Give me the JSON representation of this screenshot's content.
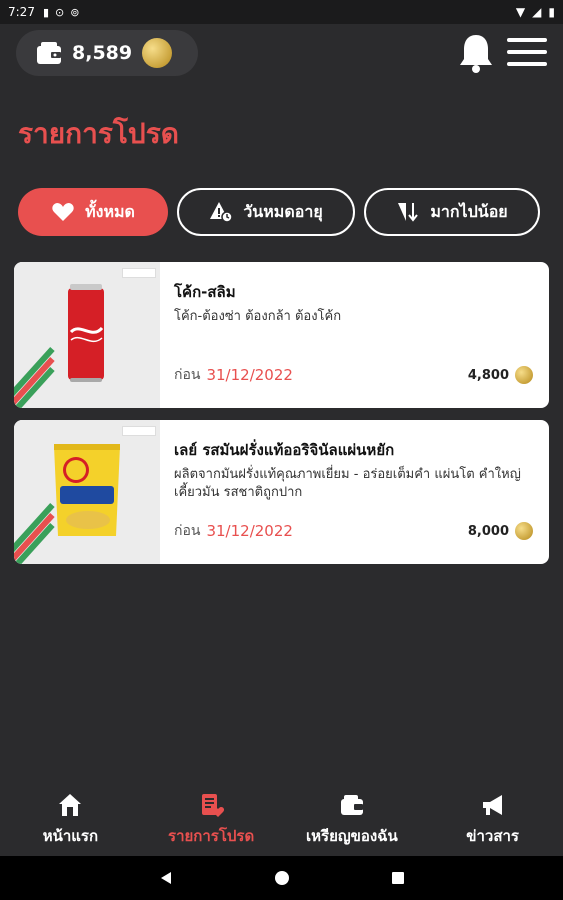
{
  "status_bar": {
    "time": "7:27"
  },
  "wallet": {
    "balance": "8,589"
  },
  "page": {
    "title": "รายการโปรด"
  },
  "filters": [
    {
      "label": "ทั้งหมด",
      "icon": "heart-icon",
      "active": true
    },
    {
      "label": "วันหมดอายุ",
      "icon": "warning-time-icon",
      "active": false
    },
    {
      "label": "มากไปน้อย",
      "icon": "sort-desc-icon",
      "active": false
    }
  ],
  "items": [
    {
      "name": "โค้ก-สลิม",
      "description": "โค้ก-ต้องซ่า ต้องกล้า ต้องโค้ก",
      "before_label": "ก่อน",
      "date": "31/12/2022",
      "price": "4,800"
    },
    {
      "name": "เลย์ รสมันฝรั่งแท้ออริจินัลแผ่นหยัก",
      "description": "ผลิตจากมันฝรั่งแท้คุณภาพเยี่ยม - อร่อยเต็มคำ แผ่นโต คำใหญ่ เคี้ยวมัน รสชาติถูกปาก",
      "before_label": "ก่อน",
      "date": "31/12/2022",
      "price": "8,000"
    }
  ],
  "bottom_nav": [
    {
      "label": "หน้าแรก",
      "icon": "home-icon",
      "active": false
    },
    {
      "label": "รายการโปรด",
      "icon": "favorites-list-icon",
      "active": true
    },
    {
      "label": "เหรียญของฉัน",
      "icon": "wallet-icon",
      "active": false
    },
    {
      "label": "ข่าวสาร",
      "icon": "megaphone-icon",
      "active": false
    }
  ],
  "colors": {
    "accent": "#e8504f",
    "background": "#2b2b2d",
    "coin": "#d4af4a"
  }
}
